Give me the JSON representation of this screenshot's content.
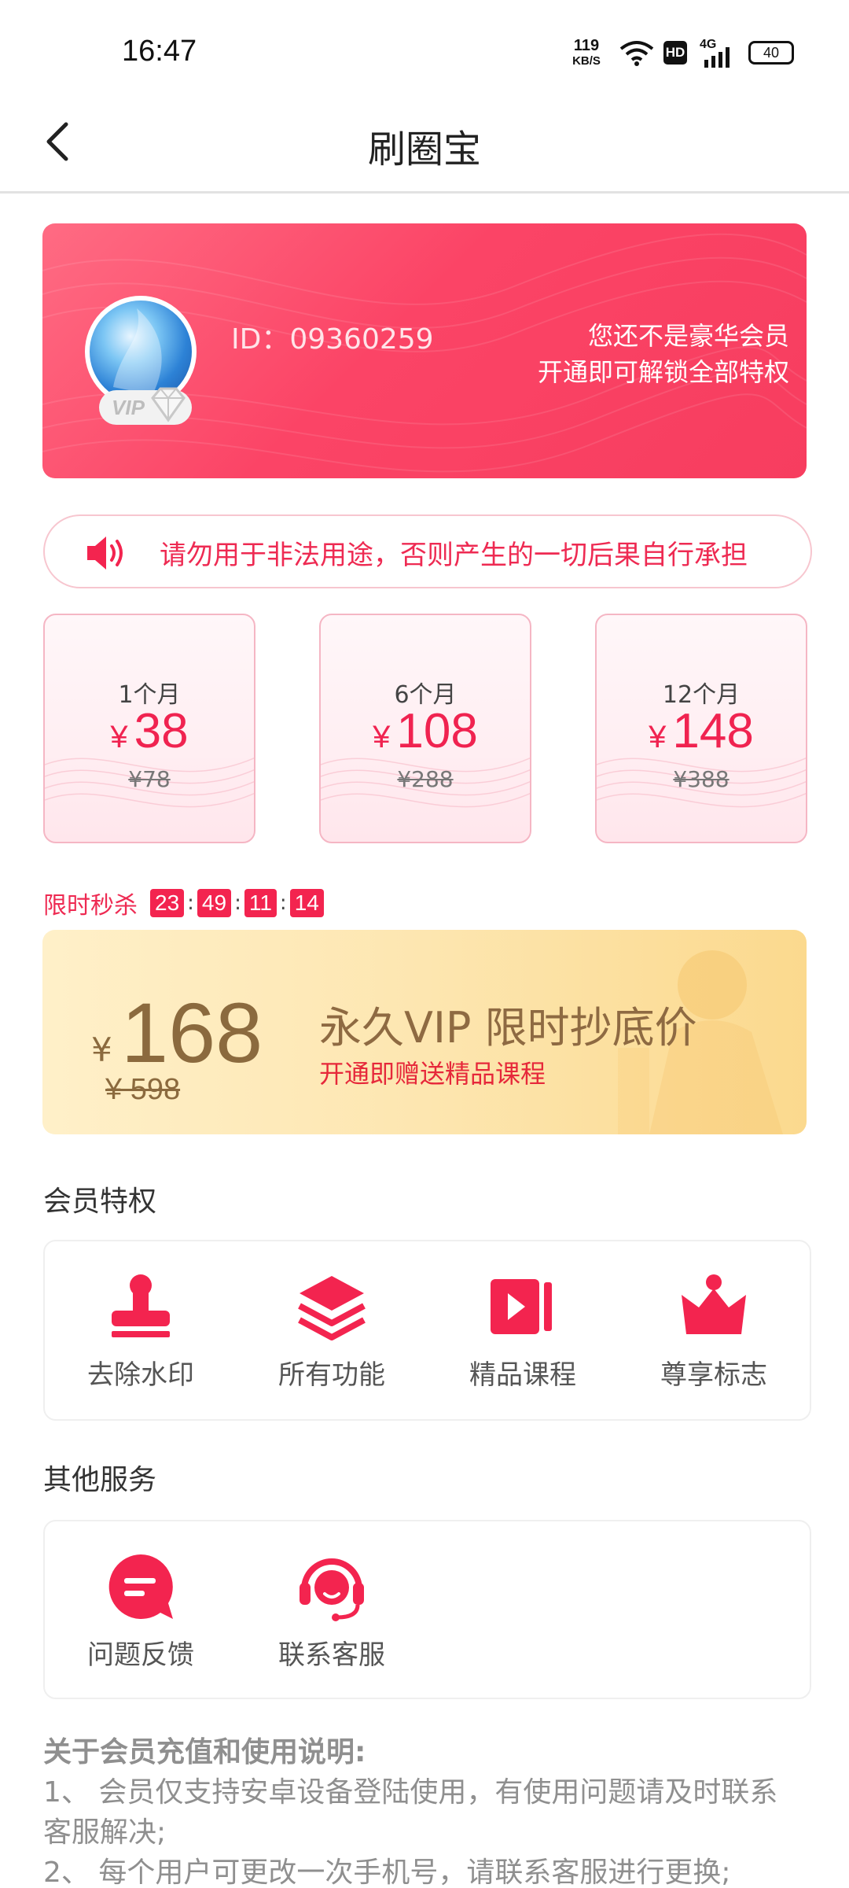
{
  "status_bar": {
    "time": "16:47",
    "net_speed_value": "119",
    "net_speed_unit": "KB/S",
    "hd": "HD",
    "network": "4G",
    "battery": "40"
  },
  "header": {
    "title": "刷圈宝"
  },
  "vip_card": {
    "user_id": "ID：09360259",
    "badge": "VIP",
    "status_line1": "您还不是豪华会员",
    "status_line2": "开通即可解锁全部特权"
  },
  "notice": {
    "text": "请勿用于非法用途，否则产生的一切后果自行承担"
  },
  "plans": [
    {
      "duration": "1个月",
      "currency": "¥",
      "price": "38",
      "original": "¥78"
    },
    {
      "duration": "6个月",
      "currency": "¥",
      "price": "108",
      "original": "¥288"
    },
    {
      "duration": "12个月",
      "currency": "¥",
      "price": "148",
      "original": "¥388"
    }
  ],
  "flash_sale": {
    "label": "限时秒杀",
    "countdown": [
      "23",
      "49",
      "11",
      "14"
    ],
    "separator": ":"
  },
  "forever_offer": {
    "currency": "¥",
    "price": "168",
    "original": "¥ 598",
    "headline": "永久VIP 限时抄底价",
    "subline": "开通即赠送精品课程"
  },
  "privileges": {
    "title": "会员特权",
    "items": [
      {
        "label": "去除水印",
        "icon": "stamp-icon"
      },
      {
        "label": "所有功能",
        "icon": "layers-icon"
      },
      {
        "label": "精品课程",
        "icon": "video-icon"
      },
      {
        "label": "尊享标志",
        "icon": "crown-icon"
      }
    ]
  },
  "services": {
    "title": "其他服务",
    "items": [
      {
        "label": "问题反馈",
        "icon": "feedback-icon"
      },
      {
        "label": "联系客服",
        "icon": "headset-icon"
      }
    ]
  },
  "notes": {
    "title": "关于会员充值和使用说明:",
    "lines": [
      "1、 会员仅支持安卓设备登陆使用，有使用问题请及时联系客服解决;",
      "2、 每个用户可更改一次手机号，请联系客服进行更换;"
    ]
  },
  "colors": {
    "accent": "#f3244f",
    "banner": "#fb4466",
    "gold_text": "#8b6a3e"
  }
}
